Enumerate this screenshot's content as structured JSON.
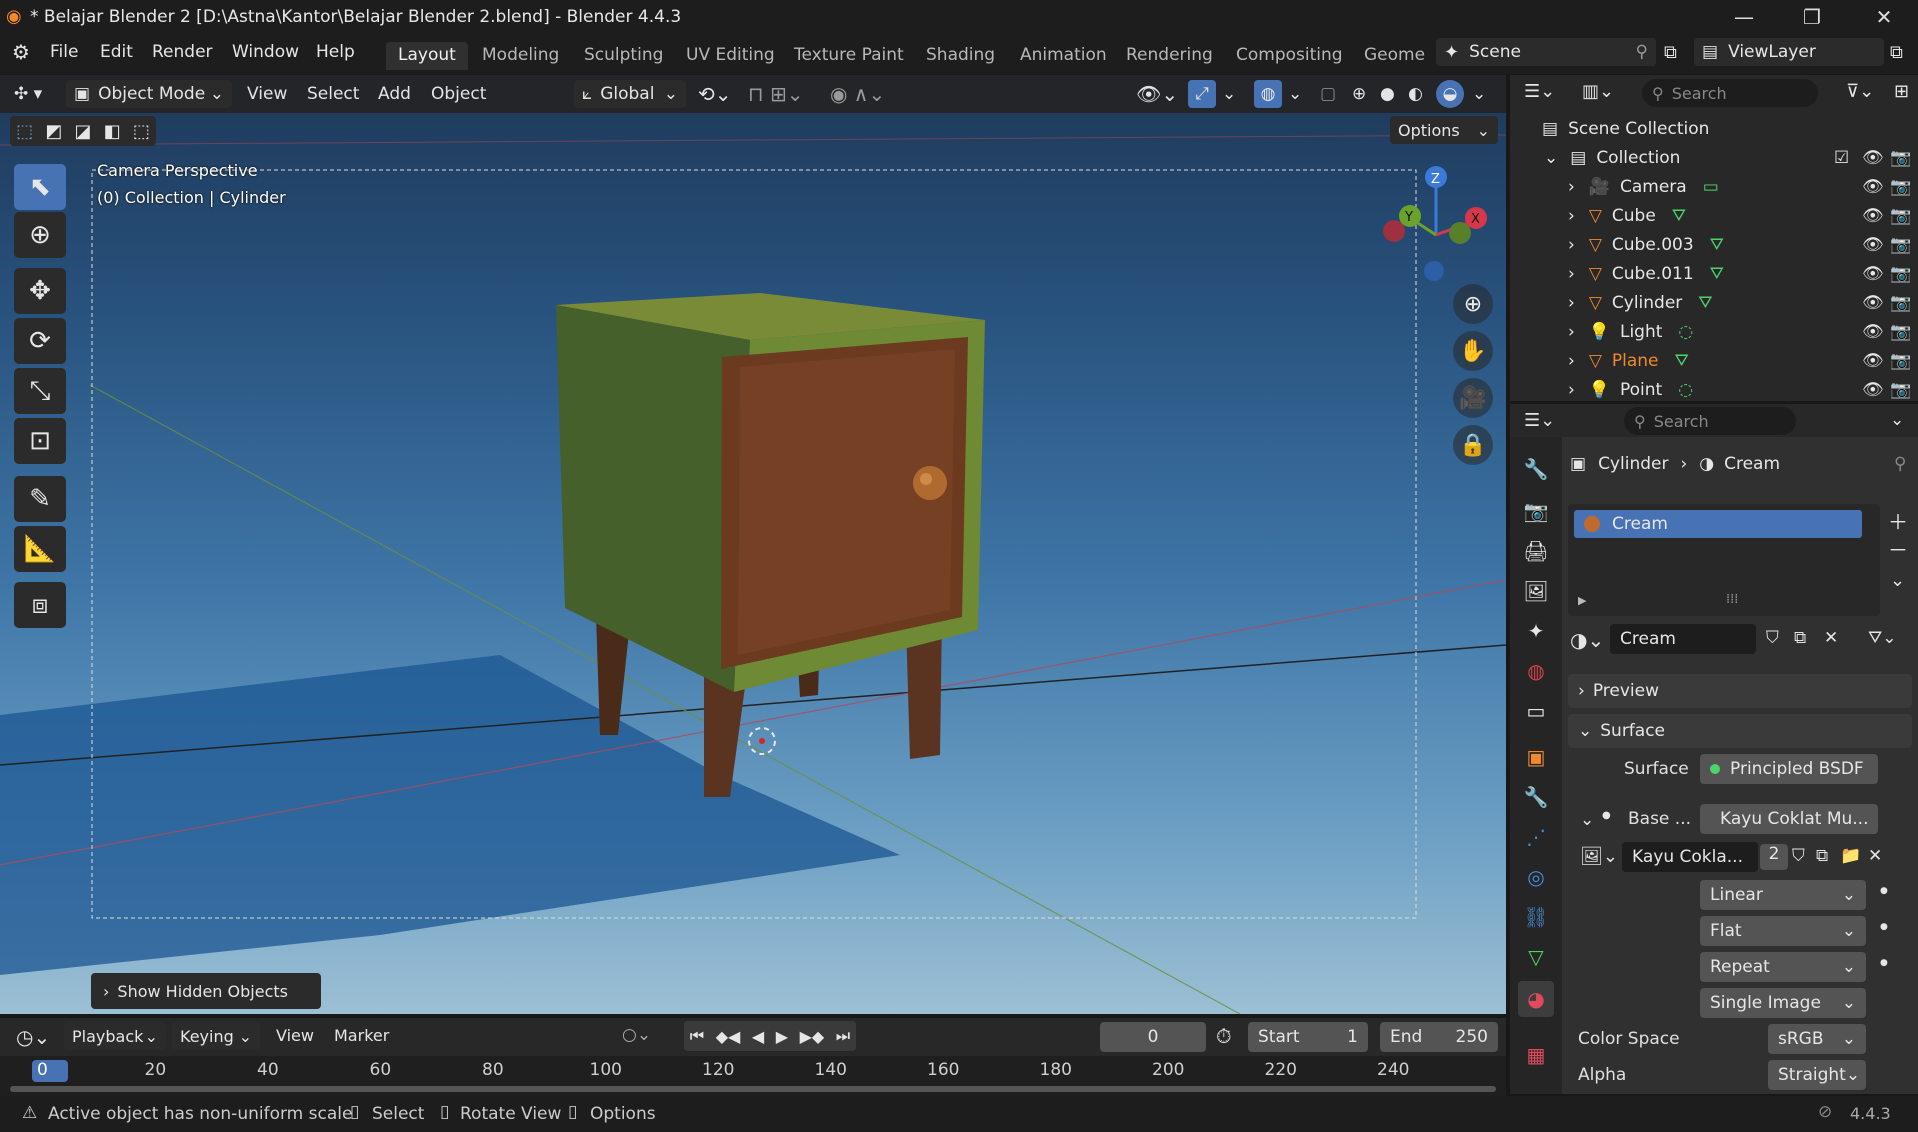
{
  "window": {
    "title": "* Belajar Blender 2 [D:\\Astna\\Kantor\\Belajar Blender 2.blend] - Blender 4.4.3"
  },
  "menu": [
    "File",
    "Edit",
    "Render",
    "Window",
    "Help"
  ],
  "workspaces": [
    "Layout",
    "Modeling",
    "Sculpting",
    "UV Editing",
    "Texture Paint",
    "Shading",
    "Animation",
    "Rendering",
    "Compositing",
    "Geome"
  ],
  "scene": {
    "label": "Scene",
    "viewlayer": "ViewLayer"
  },
  "viewport": {
    "mode": "Object Mode",
    "menus": [
      "View",
      "Select",
      "Add",
      "Object"
    ],
    "transform_orientation": "Global",
    "options_label": "Options",
    "overlay_text_1": "Camera Perspective",
    "overlay_text_2": "(0) Collection | Cylinder",
    "hidden_objects_btn": "Show Hidden Objects",
    "gizmo": {
      "z": "Z",
      "y": "Y",
      "x": "X"
    }
  },
  "outliner": {
    "search_placeholder": "Search",
    "scene_collection": "Scene Collection",
    "collection": "Collection",
    "items": [
      {
        "name": "Camera",
        "type": "camera",
        "color": "#e6e6e6"
      },
      {
        "name": "Cube",
        "type": "mesh",
        "color": "#e6e6e6"
      },
      {
        "name": "Cube.003",
        "type": "mesh",
        "color": "#e6e6e6"
      },
      {
        "name": "Cube.011",
        "type": "mesh",
        "color": "#e6e6e6"
      },
      {
        "name": "Cylinder",
        "type": "mesh",
        "color": "#e6e6e6"
      },
      {
        "name": "Light",
        "type": "light",
        "color": "#e6e6e6"
      },
      {
        "name": "Plane",
        "type": "mesh",
        "color": "#f08a2c"
      },
      {
        "name": "Point",
        "type": "light",
        "color": "#e6e6e6"
      }
    ]
  },
  "properties": {
    "search_placeholder": "Search",
    "breadcrumb_object": "Cylinder",
    "breadcrumb_material": "Cream",
    "slot_name": "Cream",
    "material_name": "Cream",
    "preview_label": "Preview",
    "surface_panel": "Surface",
    "surface_label": "Surface",
    "surface_value": "Principled BSDF",
    "base_label": "Base ...",
    "base_value": "Kayu Coklat Mu...",
    "image_name": "Kayu Cokla...",
    "image_users": "2",
    "interpolation": "Linear",
    "projection": "Flat",
    "extension": "Repeat",
    "source": "Single Image",
    "color_space_label": "Color Space",
    "color_space": "sRGB",
    "alpha_label": "Alpha",
    "alpha": "Straight"
  },
  "timeline": {
    "menus": [
      "Playback",
      "Keying",
      "View",
      "Marker"
    ],
    "current_frame": "0",
    "start_label": "Start",
    "start": "1",
    "end_label": "End",
    "end": "250",
    "ticks": [
      "0",
      "20",
      "40",
      "60",
      "80",
      "100",
      "120",
      "140",
      "160",
      "180",
      "200",
      "220",
      "240"
    ]
  },
  "status": {
    "warning": "Active object has non-uniform scale",
    "select": "Select",
    "rotate": "Rotate View",
    "options": "Options",
    "version": "4.4.3"
  },
  "colors": {
    "accent": "#4772b3",
    "selected_text": "#f08a2c"
  }
}
